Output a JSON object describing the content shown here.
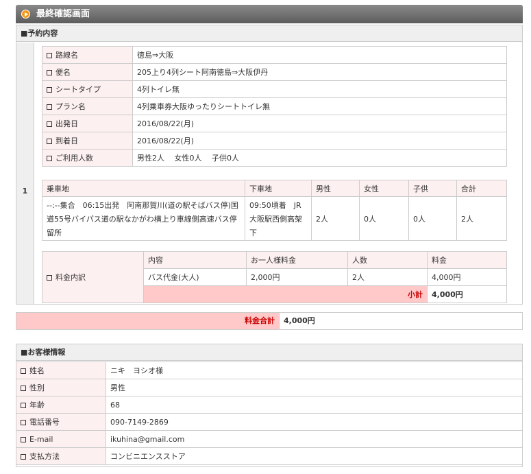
{
  "title": "最終確認画面",
  "reservation": {
    "header": "■予約内容",
    "row_number": "1",
    "info": [
      {
        "label": "路線名",
        "value": "徳島⇒大阪"
      },
      {
        "label": "便名",
        "value": "205上り4列シート阿南徳島⇒大阪伊丹"
      },
      {
        "label": "シートタイプ",
        "value": "4列トイレ無"
      },
      {
        "label": "プラン名",
        "value": "4列乗車券大阪ゆったりシートトイレ無"
      },
      {
        "label": "出発日",
        "value": "2016/08/22(月)"
      },
      {
        "label": "到着日",
        "value": "2016/08/22(月)"
      },
      {
        "label": "ご利用人数",
        "value": "男性2人　 女性0人　 子供0人"
      }
    ],
    "stops": {
      "headers": [
        "乗車地",
        "下車地",
        "男性",
        "女性",
        "子供",
        "合計"
      ],
      "row": [
        "--:--集合　06:15出発　阿南那賀川(道の駅そばバス停)国道55号バイパス道の駅なかがわ横上り車線側高速バス停留所",
        "09:50頃着　JR大阪駅西側高架下",
        "2人",
        "0人",
        "0人",
        "2人"
      ]
    },
    "fee": {
      "label": "料金内訳",
      "headers": [
        "内容",
        "お一人様料金",
        "人数",
        "料金"
      ],
      "row": [
        "バス代金(大人)",
        "2,000円",
        "2人",
        "4,000円"
      ],
      "subtotal_label": "小計",
      "subtotal_value": "4,000円"
    }
  },
  "total": {
    "label": "料金合計",
    "value": "4,000円"
  },
  "customer": {
    "header": "■お客様情報",
    "rows": [
      {
        "label": "姓名",
        "value": "ニキ　ヨシオ様"
      },
      {
        "label": "性別",
        "value": "男性"
      },
      {
        "label": "年齢",
        "value": "68"
      },
      {
        "label": "電話番号",
        "value": "090-7149-2869"
      },
      {
        "label": "E-mail",
        "value": "ikuhina@gmail.com"
      },
      {
        "label": "支払方法",
        "value": "コンビニエンスストア"
      }
    ]
  }
}
